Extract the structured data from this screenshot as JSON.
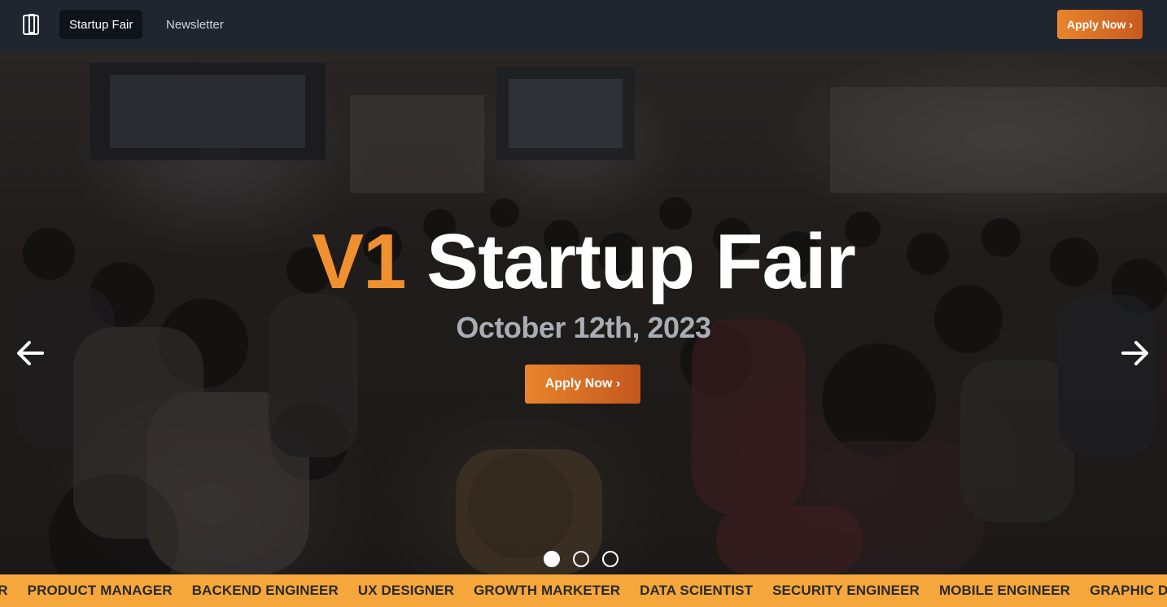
{
  "header": {
    "logo_icon": "book-logo-icon",
    "nav": [
      {
        "label": "Startup Fair",
        "active": true
      },
      {
        "label": "Newsletter",
        "active": false
      }
    ],
    "apply_label": "Apply Now ›"
  },
  "hero": {
    "title_accent": "V1",
    "title_rest": "Startup Fair",
    "date": "October 12th, 2023",
    "apply_label": "Apply Now ›",
    "prev_icon": "arrow-left-icon",
    "next_icon": "arrow-right-icon",
    "slides": 3,
    "active_slide": 1
  },
  "ticker": {
    "items": [
      "NEER",
      "PRODUCT MANAGER",
      "BACKEND ENGINEER",
      "UX DESIGNER",
      "GROWTH MARKETER",
      "DATA SCIENTIST",
      "SECURITY ENGINEER",
      "MOBILE ENGINEER",
      "GRAPHIC DESI"
    ]
  },
  "colors": {
    "accent": "#f0902f",
    "header_bg": "#1f2630",
    "ticker_bg": "#f5a73c",
    "date_text": "#a9adb5"
  }
}
